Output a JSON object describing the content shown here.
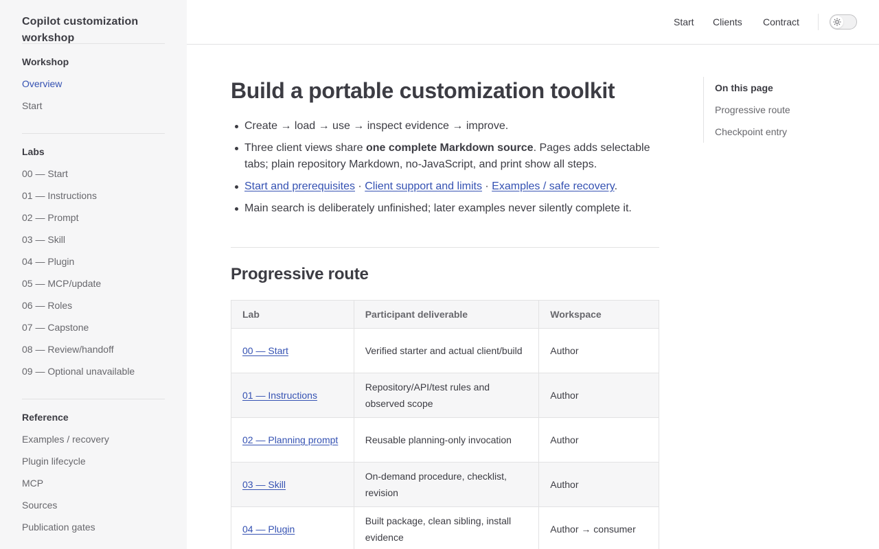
{
  "site": {
    "title": "Copilot customization workshop"
  },
  "header": {
    "nav": [
      "Start",
      "Clients",
      "Contract"
    ],
    "theme_toggle_icon": "sun-icon"
  },
  "sidebar": {
    "groups": [
      {
        "title": "Workshop",
        "items": [
          "Overview",
          "Start"
        ],
        "active": "Overview"
      },
      {
        "title": "Labs",
        "items": [
          "00 — Start",
          "01 — Instructions",
          "02 — Prompt",
          "03 — Skill",
          "04 — Plugin",
          "05 — MCP/update",
          "06 — Roles",
          "07 — Capstone",
          "08 — Review/handoff",
          "09 — Optional unavailable"
        ]
      },
      {
        "title": "Reference",
        "items": [
          "Examples / recovery",
          "Plugin lifecycle",
          "MCP",
          "Sources",
          "Publication gates"
        ]
      }
    ]
  },
  "main": {
    "title": "Build a portable customization toolkit",
    "bullets": {
      "b1": "Create → load → use → inspect evidence → improve.",
      "b2_pre": "Three client views share ",
      "b2_bold": "one complete Markdown source",
      "b2_post": ". Pages adds selectable tabs; plain repository Markdown, no-JavaScript, and print show all steps.",
      "b3_links": [
        "Start and prerequisites",
        "Client support and limits",
        "Examples / safe recovery"
      ],
      "b3_sep": " · ",
      "b3_end": ".",
      "b4": "Main search is deliberately unfinished; later examples never silently complete it."
    },
    "section_title": "Progressive route",
    "table": {
      "headers": [
        "Lab",
        "Participant deliverable",
        "Workspace"
      ],
      "rows": [
        {
          "lab": "00 — Start",
          "deliverable": "Verified starter and actual client/build",
          "workspace": "Author"
        },
        {
          "lab": "01 — Instructions",
          "deliverable": "Repository/API/test rules and observed scope",
          "workspace": "Author"
        },
        {
          "lab": "02 — Planning prompt",
          "deliverable": "Reusable planning-only invocation",
          "workspace": "Author"
        },
        {
          "lab": "03 — Skill",
          "deliverable": "On-demand procedure, checklist, revision",
          "workspace": "Author"
        },
        {
          "lab": "04 — Plugin",
          "deliverable": "Built package, clean sibling, install evidence",
          "workspace": "Author → consumer"
        }
      ]
    }
  },
  "aside": {
    "title": "On this page",
    "links": [
      "Progressive route",
      "Checkpoint entry"
    ]
  }
}
